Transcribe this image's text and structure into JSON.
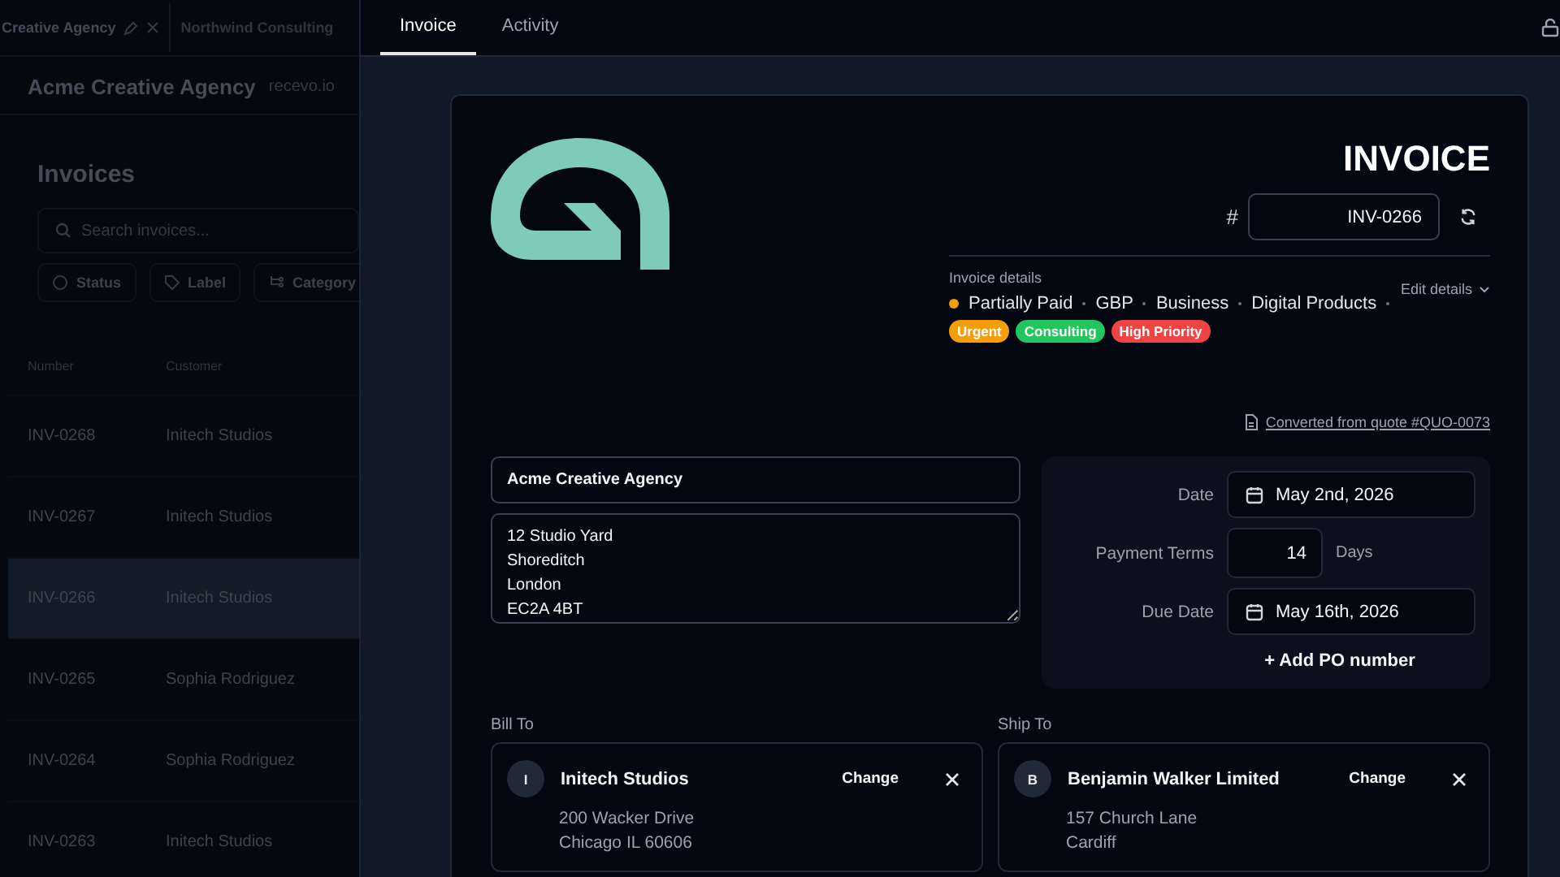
{
  "backdrop": {
    "workspace_tabs": [
      {
        "label": "Creative Agency",
        "selected": true
      },
      {
        "label": "Northwind Consulting",
        "selected": false
      }
    ],
    "company": "Acme Creative Agency",
    "domain": "recevo.io",
    "title": "Invoices",
    "search": {
      "placeholder": "Search invoices..."
    },
    "filters": [
      "Status",
      "Label",
      "Category"
    ],
    "table": {
      "columns": [
        "Number",
        "Customer"
      ],
      "rows": [
        {
          "number": "INV-0268",
          "customer": "Initech Studios",
          "selected": false
        },
        {
          "number": "INV-0267",
          "customer": "Initech Studios",
          "selected": false
        },
        {
          "number": "INV-0266",
          "customer": "Initech Studios",
          "selected": true
        },
        {
          "number": "INV-0265",
          "customer": "Sophia Rodriguez",
          "selected": false
        },
        {
          "number": "INV-0264",
          "customer": "Sophia Rodriguez",
          "selected": false
        },
        {
          "number": "INV-0263",
          "customer": "Initech Studios",
          "selected": false
        }
      ]
    }
  },
  "tabs": [
    {
      "label": "Invoice",
      "selected": true
    },
    {
      "label": "Activity",
      "selected": false
    }
  ],
  "invoice": {
    "heading": "INVOICE",
    "number_prefix": "#",
    "number": "INV-0266",
    "details_label": "Invoice details",
    "edit_details": "Edit details",
    "status": "Partially Paid",
    "meta": [
      "GBP",
      "Business",
      "Digital Products"
    ],
    "tags": [
      {
        "label": "Urgent",
        "color": "#f59e0b"
      },
      {
        "label": "Consulting",
        "color": "#22c55e"
      },
      {
        "label": "High Priority",
        "color": "#ef4444"
      }
    ],
    "converted": "Converted from quote #QUO-0073",
    "from": {
      "name": "Acme Creative Agency",
      "address": "12 Studio Yard\nShoreditch\nLondon\nEC2A 4BT"
    },
    "dates": [
      {
        "kind": "date",
        "label": "Date",
        "value": "May 2nd, 2026"
      },
      {
        "kind": "number",
        "label": "Payment Terms",
        "value": "14",
        "unit": "Days"
      },
      {
        "kind": "date",
        "label": "Due Date",
        "value": "May 16th, 2026"
      }
    ],
    "add_po": "+ Add PO number",
    "parties": [
      {
        "heading": "Bill To",
        "initial": "I",
        "name": "Initech Studios",
        "change": "Change",
        "address_lines": [
          "200 Wacker Drive",
          "Chicago IL 60606"
        ]
      },
      {
        "heading": "Ship To",
        "initial": "B",
        "name": "Benjamin Walker Limited",
        "change": "Change",
        "address_lines": [
          "157 Church Lane",
          "Cardiff"
        ]
      }
    ]
  }
}
